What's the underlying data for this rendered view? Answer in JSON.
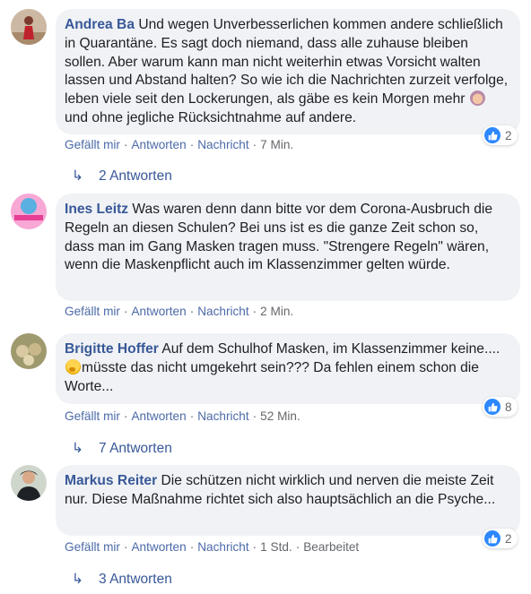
{
  "colors": {
    "bubble": "#f0f2f5",
    "author": "#385898",
    "link": "#4b6aa8",
    "meta": "#65676b",
    "like": "#2d88ff"
  },
  "comments": [
    {
      "author": "Andrea Ba",
      "text_before_emoji": "Und wegen Unverbesserlichen kommen andere schließlich in Quarantäne. Es sagt doch niemand, dass alle zuhause bleiben sollen. Aber warum kann man nicht weiterhin etwas Vorsicht walten lassen und Abstand halten? So wie ich die Nachrichten zurzeit verfolge, leben viele seit den Lockerungen, als gäbe es kein Morgen mehr",
      "emoji": "facepalm-emoji",
      "text_after_emoji": "und ohne jegliche Rücksichtnahme auf andere.",
      "like_label": "Gefällt mir",
      "reply_label": "Antworten",
      "message_label": "Nachricht",
      "time": "7 Min.",
      "reaction_icon": "like-icon",
      "reaction_count": "2",
      "replies_label": "2 Antworten"
    },
    {
      "author": "Ines Leitz",
      "text": "Was waren denn dann bitte vor dem Corona-Ausbruch die Regeln an diesen Schulen? Bei uns ist es die ganze Zeit schon so, dass man im Gang Masken tragen muss. \"Strengere Regeln\" wären, wenn die Maskenpflicht auch im Klassenzimmer gelten würde.",
      "like_label": "Gefällt mir",
      "reply_label": "Antworten",
      "message_label": "Nachricht",
      "time": "2 Min."
    },
    {
      "author": "Brigitte Hoffer",
      "text_before_emoji": "Auf dem Schulhof Masken, im Klassenzimmer keine....",
      "emoji": "thinking-emoji",
      "text_after_emoji": "müsste das nicht umgekehrt sein??? Da fehlen einem schon die Worte...",
      "like_label": "Gefällt mir",
      "reply_label": "Antworten",
      "message_label": "Nachricht",
      "time": "52 Min.",
      "reaction_icon": "like-icon",
      "reaction_count": "8",
      "replies_label": "7 Antworten"
    },
    {
      "author": "Markus Reiter",
      "text": "Die schützen nicht wirklich und nerven die meiste Zeit nur. Diese Maßnahme richtet sich also hauptsächlich an die Psyche...",
      "like_label": "Gefällt mir",
      "reply_label": "Antworten",
      "message_label": "Nachricht",
      "time": "1 Std.",
      "edited_label": "Bearbeitet",
      "reaction_icon": "like-icon",
      "reaction_count": "2",
      "replies_label": "3 Antworten"
    }
  ]
}
